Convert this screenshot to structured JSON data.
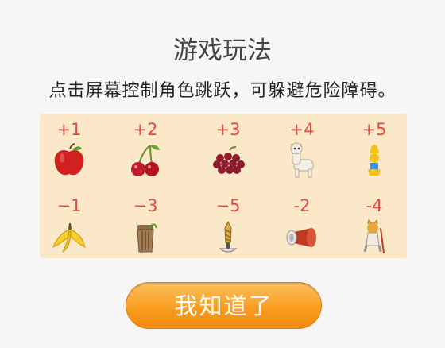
{
  "title": "游戏玩法",
  "description": "点击屏幕控制角色跳跃，可躲避危险障碍。",
  "bonus_items": [
    {
      "score": "+1",
      "icon": "apple-icon"
    },
    {
      "score": "+2",
      "icon": "cherry-icon"
    },
    {
      "score": "+3",
      "icon": "grapes-icon"
    },
    {
      "score": "+4",
      "icon": "alpaca-icon"
    },
    {
      "score": "+5",
      "icon": "golden-statue-icon"
    }
  ],
  "penalty_items": [
    {
      "score": "−1",
      "icon": "banana-peel-icon"
    },
    {
      "score": "−3",
      "icon": "trash-can-icon"
    },
    {
      "score": "−5",
      "icon": "drill-icon"
    },
    {
      "score": "-2",
      "icon": "megaphone-icon"
    },
    {
      "score": "-4",
      "icon": "cat-figure-icon"
    }
  ],
  "confirm_button": "我知道了",
  "colors": {
    "background": "#f6f6f6",
    "panel": "#fbe8c8",
    "score": "#e8483c",
    "button": "#f99d21"
  }
}
